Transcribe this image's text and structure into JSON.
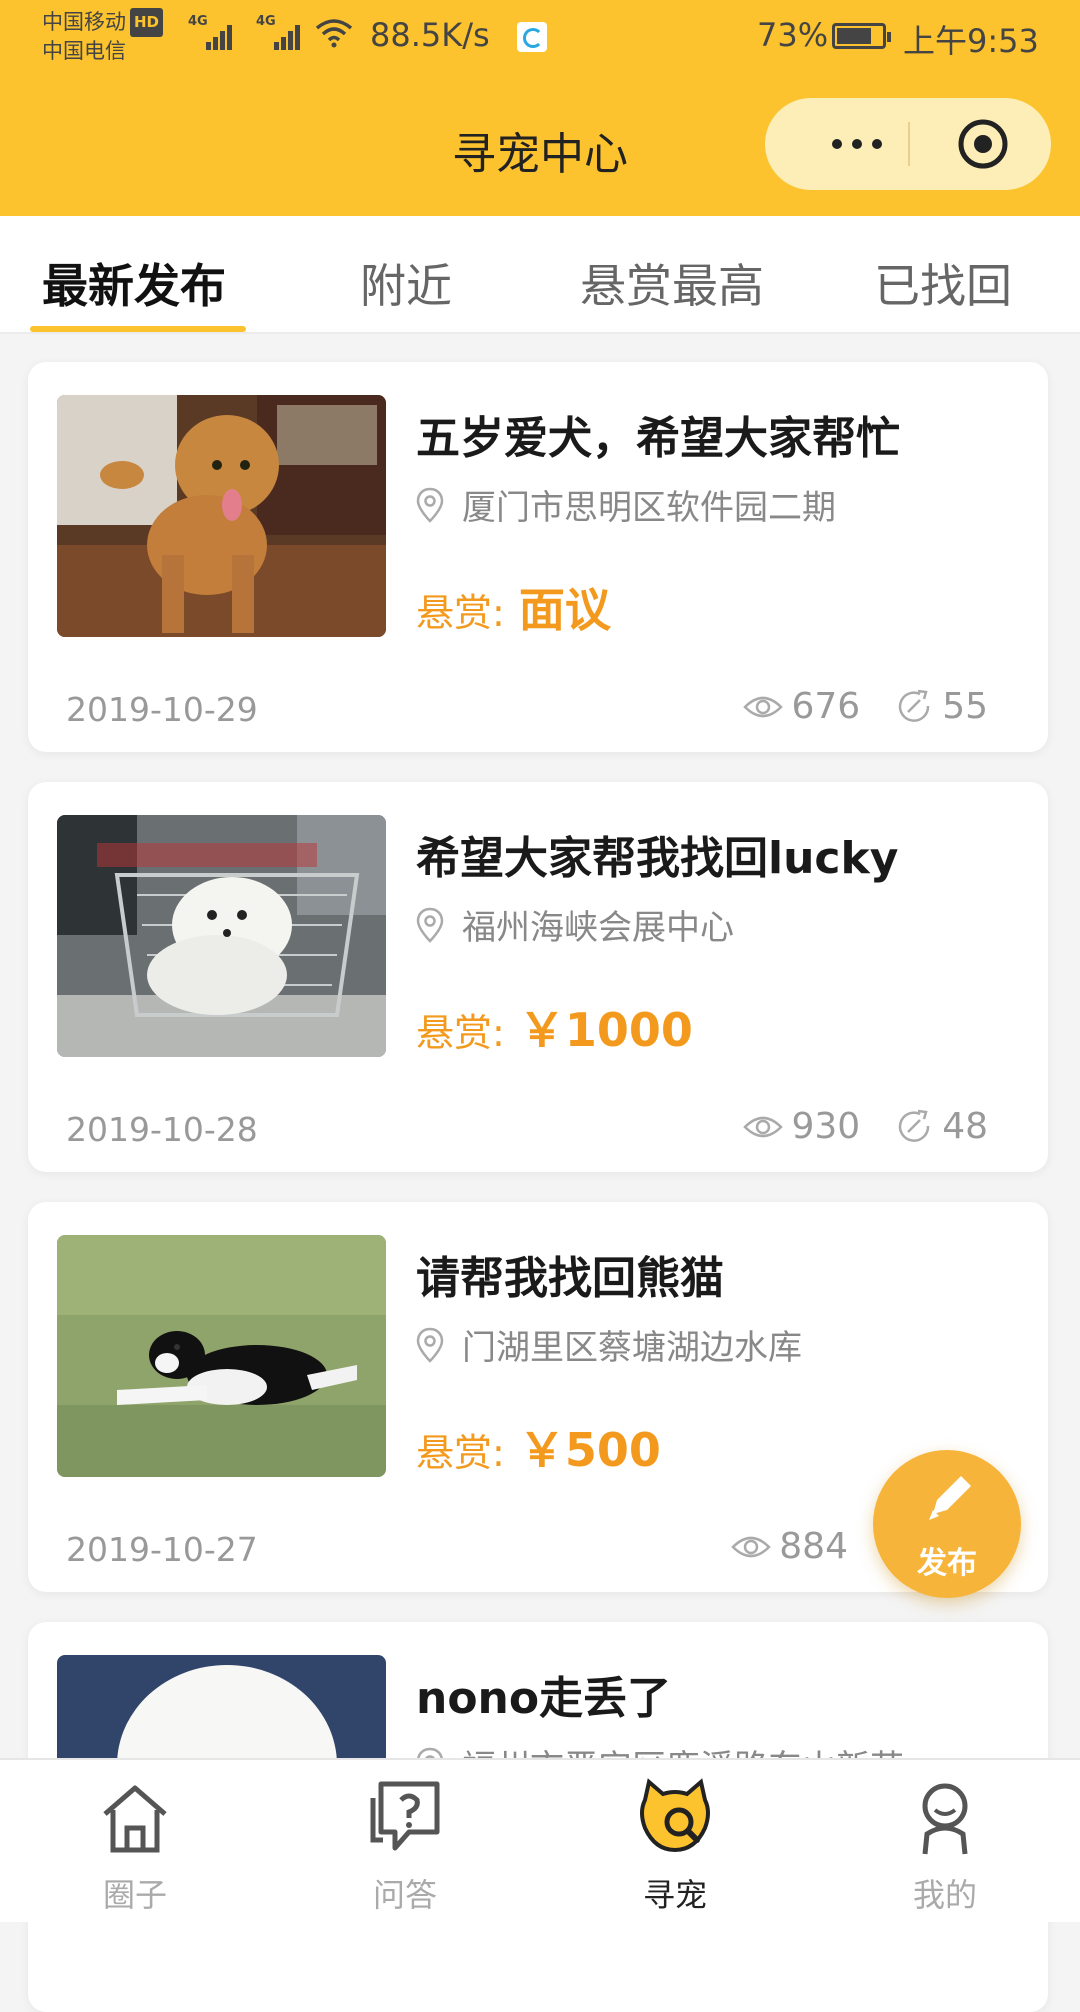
{
  "status_bar": {
    "carrier1": "中国移动",
    "hd_badge": "HD",
    "carrier2": "中国电信",
    "net1": "4G",
    "net2": "4G",
    "speed": "88.5K/s",
    "battery": "73%",
    "time": "上午9:53"
  },
  "nav": {
    "title": "寻宠中心"
  },
  "tabs": [
    {
      "label": "最新发布",
      "active": true
    },
    {
      "label": "附近",
      "active": false
    },
    {
      "label": "悬赏最高",
      "active": false
    },
    {
      "label": "已找回",
      "active": false
    }
  ],
  "posts": [
    {
      "title": "五岁爱犬，希望大家帮忙",
      "location": "厦门市思明区软件园二期",
      "reward_label": "悬赏:",
      "reward_value": "面议",
      "date": "2019-10-29",
      "views": "676",
      "shares": "55"
    },
    {
      "title": "希望大家帮我找回lucky",
      "location": "福州海峡会展中心",
      "reward_label": "悬赏:",
      "reward_value": "￥1000",
      "date": "2019-10-28",
      "views": "930",
      "shares": "48"
    },
    {
      "title": "请帮我找回熊猫",
      "location": "门湖里区蔡塘湖边水库",
      "reward_label": "悬赏:",
      "reward_value": "￥500",
      "date": "2019-10-27",
      "views": "884",
      "shares": ""
    },
    {
      "title": "nono走丢了",
      "location": "福州市晋安区鹿溪路东山新苑",
      "reward_label": "",
      "reward_value": "",
      "date": "",
      "views": "",
      "shares": ""
    }
  ],
  "fab": {
    "label": "发布"
  },
  "bottom_tabs": [
    {
      "label": "圈子",
      "icon": "home-icon",
      "active": false
    },
    {
      "label": "问答",
      "icon": "question-chat-icon",
      "active": false
    },
    {
      "label": "寻宠",
      "icon": "cat-search-icon",
      "active": true
    },
    {
      "label": "我的",
      "icon": "profile-icon",
      "active": false
    }
  ],
  "colors": {
    "brand_yellow": "#fcc32e",
    "reward_orange": "#f39a1e",
    "fab": "#f7b43a"
  }
}
